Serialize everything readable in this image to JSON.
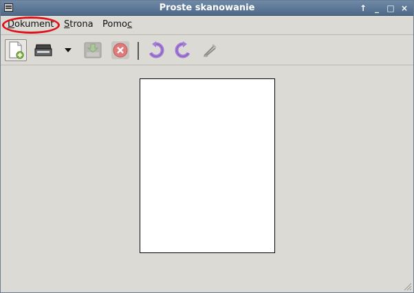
{
  "window": {
    "title": "Proste skanowanie"
  },
  "menu": {
    "items": [
      {
        "label": "Dokument",
        "accel_index": 0
      },
      {
        "label": "Strona",
        "accel_index": 0
      },
      {
        "label": "Pomoc",
        "accel_index": 4
      }
    ]
  },
  "toolbar": {
    "buttons": [
      {
        "icon": "new-document-icon"
      },
      {
        "icon": "scanner-icon"
      },
      {
        "icon": "dropdown-arrow-icon"
      },
      {
        "icon": "save-icon"
      },
      {
        "icon": "stop-icon"
      },
      {
        "icon": "rotate-left-icon"
      },
      {
        "icon": "rotate-right-icon"
      },
      {
        "icon": "crop-icon"
      }
    ]
  },
  "colors": {
    "titlebar": "#5a7593",
    "highlight": "#e0101a",
    "stop": "#d94040",
    "rotate": "#9b6fd1"
  }
}
